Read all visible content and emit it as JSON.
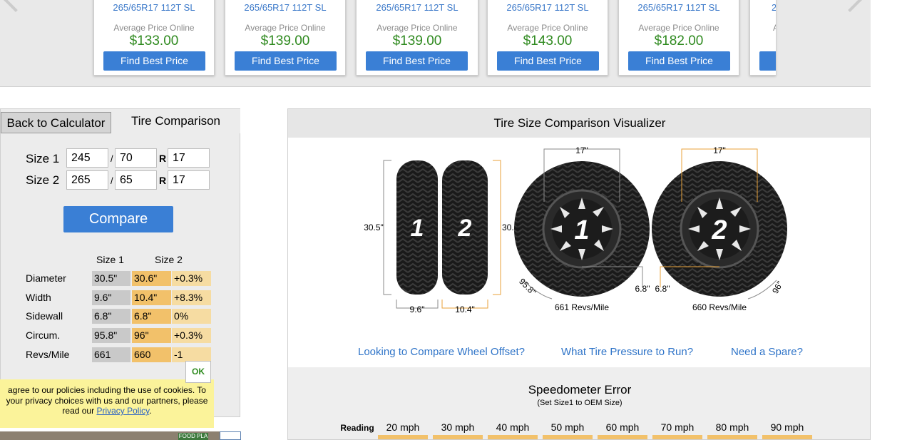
{
  "carousel": {
    "cards": [
      {
        "size": "265/65R17 112T SL",
        "avg_label": "Average Price Online",
        "price": "$133.00",
        "button": "Find Best Price"
      },
      {
        "size": "265/65R17 112T SL",
        "avg_label": "Average Price Online",
        "price": "$139.00",
        "button": "Find Best Price"
      },
      {
        "size": "265/65R17 112T SL",
        "avg_label": "Average Price Online",
        "price": "$139.00",
        "button": "Find Best Price"
      },
      {
        "size": "265/65R17 112T SL",
        "avg_label": "Average Price Online",
        "price": "$143.00",
        "button": "Find Best Price"
      },
      {
        "size": "265/65R17 112T SL",
        "avg_label": "Average Price Online",
        "price": "$182.00",
        "button": "Find Best Price"
      },
      {
        "size": "2",
        "avg_label": "A",
        "price": "",
        "button": ""
      }
    ]
  },
  "calculator": {
    "tabs": {
      "back": "Back to Calculator",
      "compare": "Tire Comparison"
    },
    "size1": {
      "label": "Size 1",
      "width": "245",
      "ratio": "70",
      "rim": "17"
    },
    "size2": {
      "label": "Size 2",
      "width": "265",
      "ratio": "65",
      "rim": "17"
    },
    "slash": "/",
    "r": "R",
    "compare_button": "Compare",
    "headers": {
      "size1": "Size 1",
      "size2": "Size 2"
    },
    "rows": [
      {
        "label": "Diameter",
        "s1": "30.5\"",
        "s2": "30.6\"",
        "diff": "+0.3%"
      },
      {
        "label": "Width",
        "s1": "9.6\"",
        "s2": "10.4\"",
        "diff": "+8.3%"
      },
      {
        "label": "Sidewall",
        "s1": "6.8\"",
        "s2": "6.8\"",
        "diff": "0%"
      },
      {
        "label": "Circum.",
        "s1": "95.8\"",
        "s2": "96\"",
        "diff": "+0.3%"
      },
      {
        "label": "Revs/Mile",
        "s1": "661",
        "s2": "660",
        "diff": "-1"
      }
    ]
  },
  "cookie": {
    "line1": "agree to our policies including the use of cookies. To",
    "line2": "your privacy choices with us and our partners, please",
    "line3_pre": "read our ",
    "link": "Privacy Policy",
    "line3_post": ".",
    "ok": "OK"
  },
  "ad": {
    "tag": "FOOD PLA"
  },
  "visualizer": {
    "title": "Tire Size Comparison Visualizer",
    "tire1": {
      "num": "1",
      "diameter": "30.5\"",
      "width": "9.6\"",
      "rim": "17\"",
      "sidewall": "6.8\"",
      "circum": "95.8\"",
      "revs": "661 Revs/Mile"
    },
    "tire2": {
      "num": "2",
      "diameter": "30.6\"",
      "width": "10.4\"",
      "rim": "17\"",
      "sidewall": "6.8\"",
      "circum": "96\"",
      "revs": "660 Revs/Mile"
    },
    "colors": {
      "tire1_dim": "#8a8a8a",
      "tire2_dim": "#e8a23a"
    },
    "links": [
      "Looking to Compare Wheel Offset?",
      "What Tire Pressure to Run?",
      "Need a Spare?"
    ]
  },
  "speedometer": {
    "title": "Speedometer Error",
    "subtitle": "(Set Size1 to OEM Size)",
    "reading_label": "Reading",
    "readings": [
      "20 mph",
      "30 mph",
      "40 mph",
      "50 mph",
      "60 mph",
      "70 mph",
      "80 mph",
      "90 mph"
    ]
  }
}
